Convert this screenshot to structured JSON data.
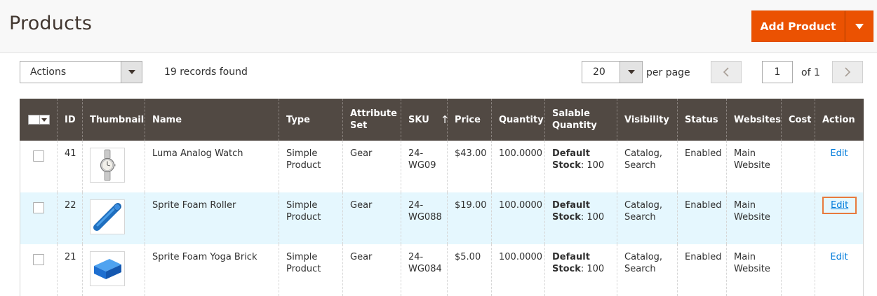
{
  "header": {
    "title": "Products",
    "add_button": "Add Product"
  },
  "toolbar": {
    "actions_label": "Actions",
    "records_found": "19 records found",
    "per_page_value": "20",
    "per_page_label": "per page",
    "current_page": "1",
    "of_pages": "of 1"
  },
  "grid": {
    "columns": {
      "id": "ID",
      "thumbnail": "Thumbnail",
      "name": "Name",
      "type": "Type",
      "attribute_set": "Attribute Set",
      "sku": "SKU",
      "price": "Price",
      "quantity": "Quantity",
      "salable_quantity": "Salable Quantity",
      "visibility": "Visibility",
      "status": "Status",
      "websites": "Websites",
      "cost": "Cost",
      "action": "Action"
    },
    "rows": [
      {
        "id": "41",
        "name": "Luma Analog Watch",
        "type": "Simple Product",
        "attribute_set": "Gear",
        "sku": "24-WG09",
        "price": "$43.00",
        "quantity": "100.0000",
        "stock_label": "Default Stock",
        "stock_qty": ": 100",
        "visibility": "Catalog, Search",
        "status": "Enabled",
        "websites": "Main Website",
        "cost": "",
        "action": "Edit",
        "thumb_icon": "watch-icon"
      },
      {
        "id": "22",
        "name": "Sprite Foam Roller",
        "type": "Simple Product",
        "attribute_set": "Gear",
        "sku": "24-WG088",
        "price": "$19.00",
        "quantity": "100.0000",
        "stock_label": "Default Stock",
        "stock_qty": ": 100",
        "visibility": "Catalog, Search",
        "status": "Enabled",
        "websites": "Main Website",
        "cost": "",
        "action": "Edit",
        "thumb_icon": "foam-roller-icon"
      },
      {
        "id": "21",
        "name": "Sprite Foam Yoga Brick",
        "type": "Simple Product",
        "attribute_set": "Gear",
        "sku": "24-WG084",
        "price": "$5.00",
        "quantity": "100.0000",
        "stock_label": "Default Stock",
        "stock_qty": ": 100",
        "visibility": "Catalog, Search",
        "status": "Enabled",
        "websites": "Main Website",
        "cost": "",
        "action": "Edit",
        "thumb_icon": "yoga-brick-icon"
      }
    ]
  },
  "colors": {
    "accent": "#eb5202",
    "header_bg": "#514943",
    "link": "#007bdb",
    "row_hover": "#e5f7fe",
    "highlight_border": "#e87a3e"
  }
}
